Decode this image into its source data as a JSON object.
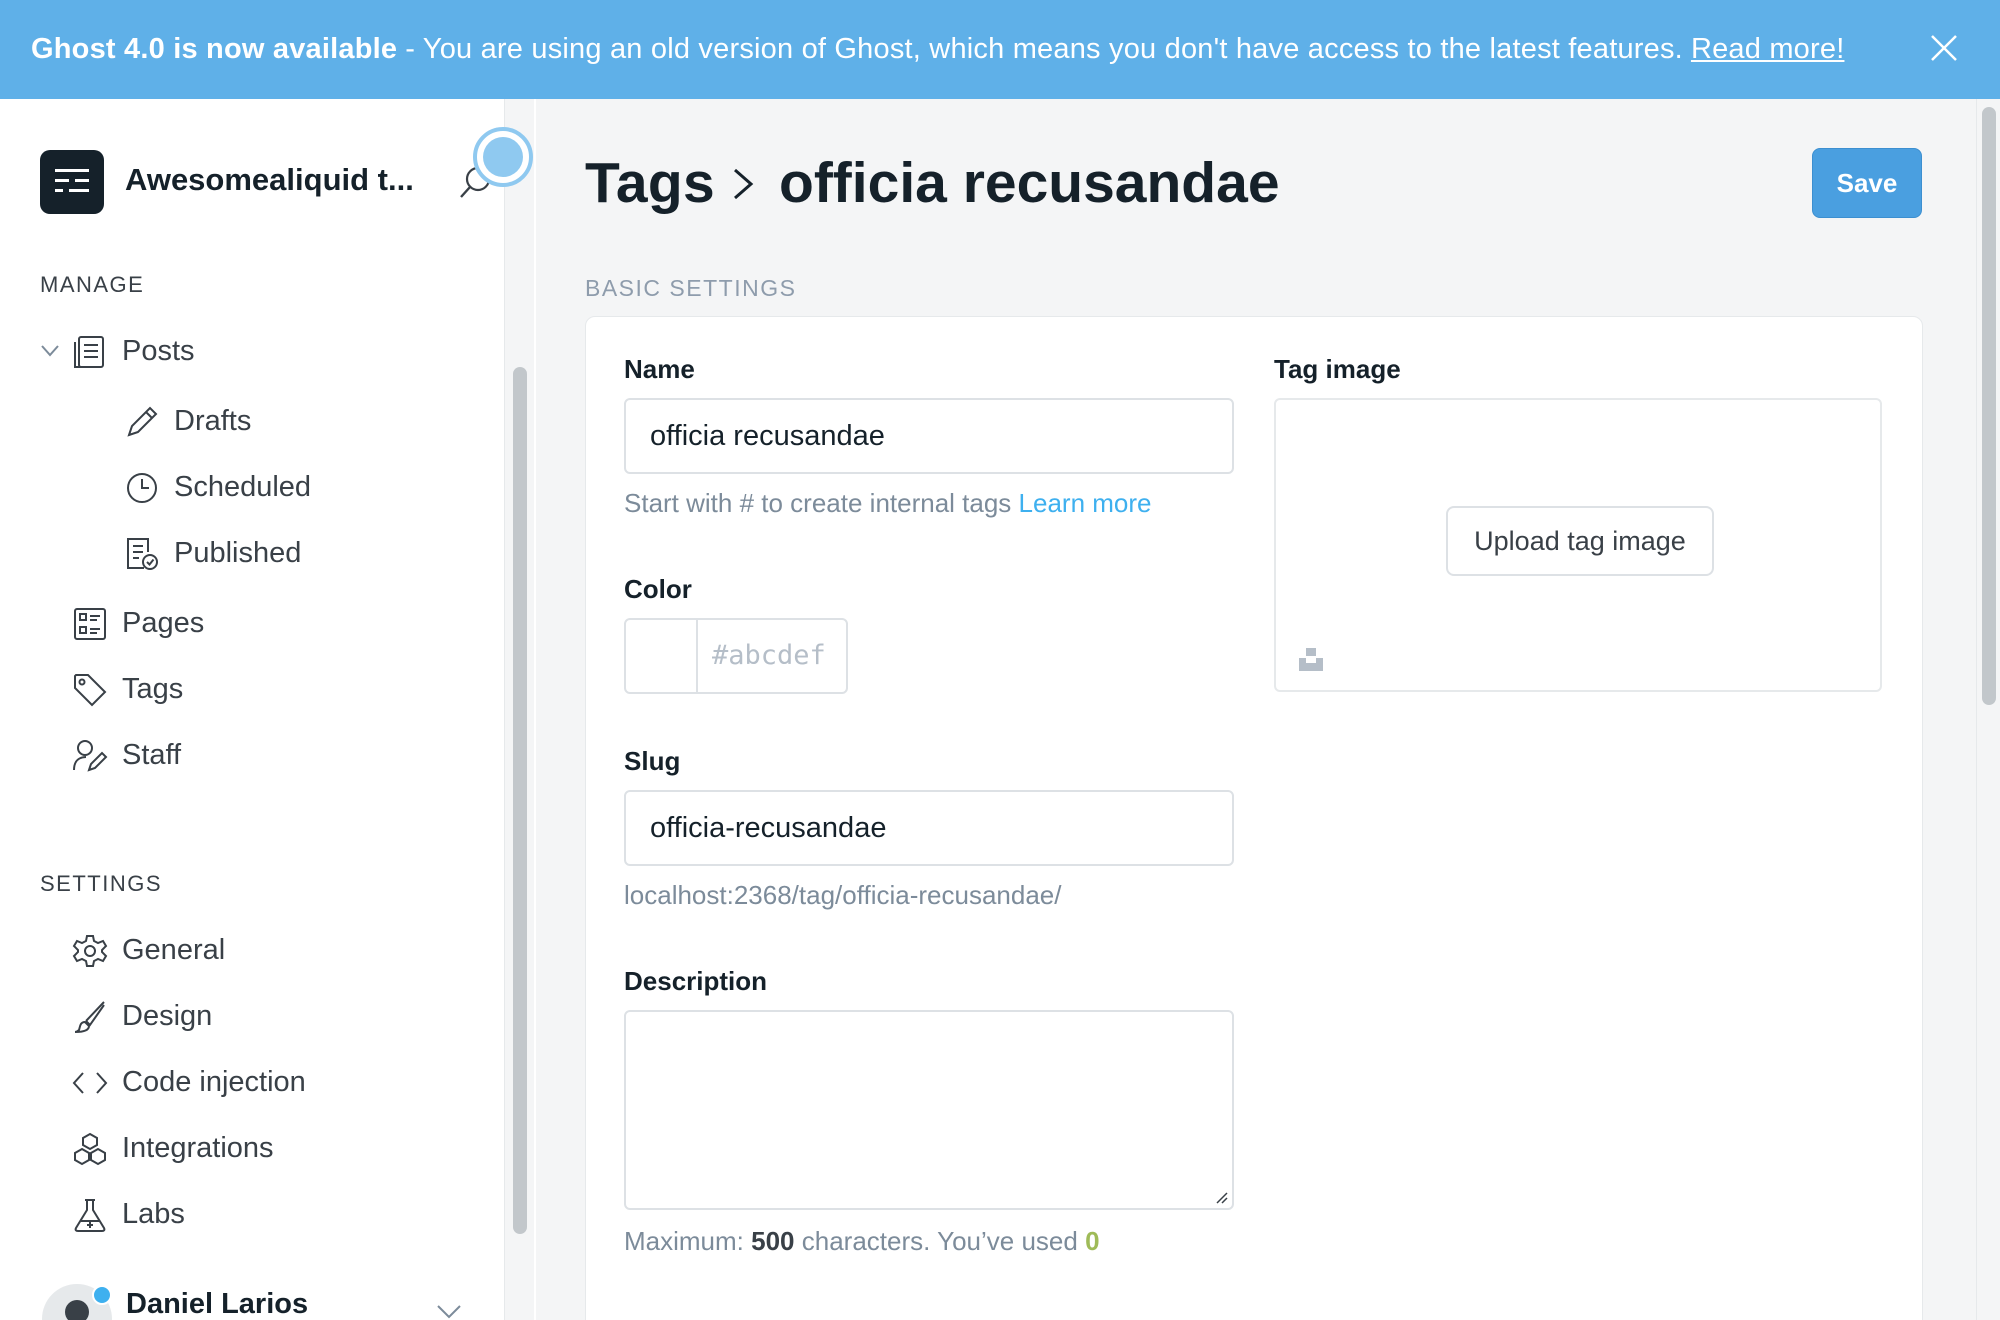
{
  "banner": {
    "title": "Ghost 4.0 is now available",
    "message": "- You are using an old version of Ghost, which means you don't have access to the latest features.",
    "link": "Read more!",
    "bg_color": "#5fb0e8"
  },
  "sidebar": {
    "site_title": "Awesomealiquid t...",
    "manage_label": "MANAGE",
    "settings_label": "SETTINGS",
    "manage_items": [
      {
        "label": "Posts",
        "icon": "posts-icon"
      },
      {
        "label": "Drafts",
        "icon": "pencil-icon"
      },
      {
        "label": "Scheduled",
        "icon": "clock-icon"
      },
      {
        "label": "Published",
        "icon": "published-icon"
      },
      {
        "label": "Pages",
        "icon": "pages-icon"
      },
      {
        "label": "Tags",
        "icon": "tag-icon"
      },
      {
        "label": "Staff",
        "icon": "staff-icon"
      }
    ],
    "settings_items": [
      {
        "label": "General",
        "icon": "gear-icon"
      },
      {
        "label": "Design",
        "icon": "brush-icon"
      },
      {
        "label": "Code injection",
        "icon": "code-icon"
      },
      {
        "label": "Integrations",
        "icon": "cubes-icon"
      },
      {
        "label": "Labs",
        "icon": "flask-icon"
      }
    ],
    "user_name": "Daniel Larios"
  },
  "main": {
    "breadcrumb_parent": "Tags",
    "breadcrumb_current": "officia recusandae",
    "save_label": "Save",
    "section_title": "BASIC SETTINGS",
    "name_label": "Name",
    "name_value": "officia recusandae",
    "name_hint": "Start with # to create internal tags",
    "name_hint_link": "Learn more",
    "color_label": "Color",
    "color_placeholder": "abcdef",
    "slug_label": "Slug",
    "slug_value": "officia-recusandae",
    "slug_url": "localhost:2368/tag/officia-recusandae/",
    "description_label": "Description",
    "desc_hint_prefix": "Maximum:",
    "desc_max": "500",
    "desc_hint_mid": "characters. You’ve used",
    "desc_used": "0",
    "tag_image_label": "Tag image",
    "upload_label": "Upload tag image"
  },
  "colors": {
    "accent": "#3eb0ef",
    "save": "#4a9fe0",
    "used_count": "#9fbb58"
  }
}
